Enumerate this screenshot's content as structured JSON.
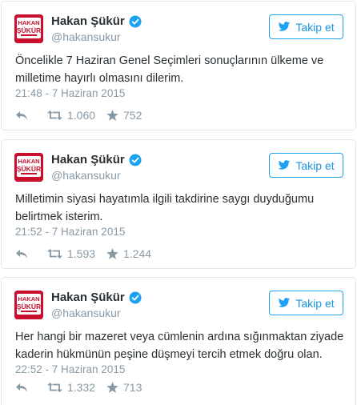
{
  "colors": {
    "accent": "#1da1f2",
    "text": "#292f33",
    "muted": "#8899a6",
    "avatar_red": "#c8102e",
    "border": "#e1e8ed"
  },
  "icons": {
    "reply": "reply-icon",
    "retweet": "retweet-icon",
    "like": "star-icon",
    "verified": "verified-badge-icon",
    "follow": "bird-plus-icon"
  },
  "avatar": {
    "line1": "HAKAN",
    "line2": "ŞÜKÜR"
  },
  "follow_label": "Takip et",
  "tweets": [
    {
      "name": "Hakan Şükür",
      "handle": "@hakansukur",
      "text": "Öncelikle 7 Haziran Genel Seçimleri sonuçlarının ülkeme ve milletime hayırlı olmasını dilerim.",
      "timestamp": "21:48 - 7 Haziran 2015",
      "retweets": "1.060",
      "likes": "752"
    },
    {
      "name": "Hakan Şükür",
      "handle": "@hakansukur",
      "text": "Milletimin siyasi hayatımla ilgili takdirine saygı duyduğumu belirtmek isterim.",
      "timestamp": "21:52 - 7 Haziran 2015",
      "retweets": "1.593",
      "likes": "1.244"
    },
    {
      "name": "Hakan Şükür",
      "handle": "@hakansukur",
      "text": "Her hangi bir mazeret veya cümlenin ardına sığınmaktan ziyade kaderin hükmünün peşine düşmeyi tercih etmek doğru olan.",
      "timestamp": "22:52 - 7 Haziran 2015",
      "retweets": "1.332",
      "likes": "713"
    }
  ]
}
